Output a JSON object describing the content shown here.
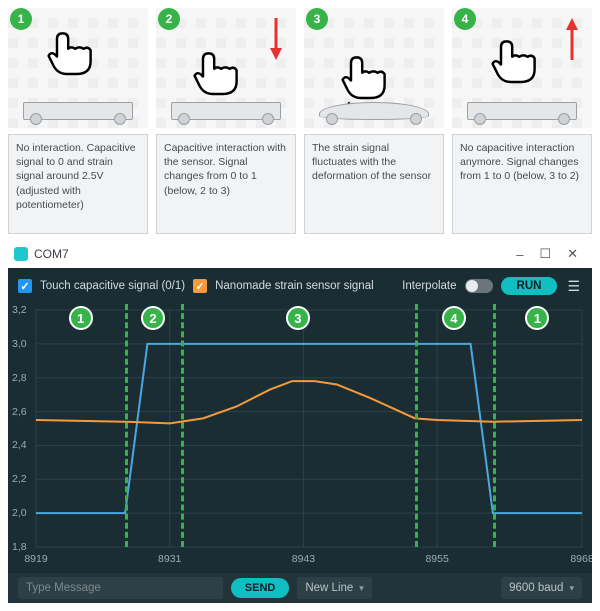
{
  "colors": {
    "badge": "#37b34a",
    "cap": "#4aa8e0",
    "strain": "#f59a3c"
  },
  "steps": [
    {
      "n": "1",
      "caption": "No interaction. Capacitive signal to 0 and strain signal around 2.5V (adjusted with potentiometer)"
    },
    {
      "n": "2",
      "caption": "Capacitive interaction with the sensor. Signal changes from 0 to 1 (below, 2 to 3)"
    },
    {
      "n": "3",
      "caption": "The strain signal fluctuates with the deformation of the sensor"
    },
    {
      "n": "4",
      "caption": "No capacitive interaction anymore. Signal changes from 1 to 0 (below, 3 to 2)"
    }
  ],
  "window": {
    "title": "COM7",
    "minimize": "–",
    "maximize": "☐",
    "close": "✕"
  },
  "legend": {
    "capacitive": "Touch capacitive signal (0/1)",
    "strain": "Nanomade strain sensor signal",
    "interpolate": "Interpolate",
    "run": "RUN",
    "menu": "☰"
  },
  "footer": {
    "placeholder": "Type Message",
    "send": "SEND",
    "line_ending": "New Line",
    "baud": "9600 baud"
  },
  "chart_data": {
    "type": "line",
    "xlim": [
      8919,
      8968
    ],
    "ylim": [
      1.8,
      3.2
    ],
    "xlabel": "",
    "ylabel": "",
    "xticks": [
      8919,
      8931,
      8943,
      8955,
      8968
    ],
    "yticks": [
      1.8,
      2.0,
      2.2,
      2.4,
      2.6,
      2.8,
      3.0,
      3.2
    ],
    "region_dividers": [
      8927,
      8932,
      8953,
      8960
    ],
    "region_labels": [
      "1",
      "2",
      "3",
      "4",
      "1"
    ],
    "series": [
      {
        "name": "Touch capacitive signal (0/1)",
        "color": "#4aa8e0",
        "x": [
          8919,
          8927,
          8929,
          8958,
          8960,
          8968
        ],
        "y": [
          2.0,
          2.0,
          3.0,
          3.0,
          2.0,
          2.0
        ]
      },
      {
        "name": "Nanomade strain sensor signal",
        "color": "#f59a3c",
        "x": [
          8919,
          8927,
          8931,
          8934,
          8937,
          8940,
          8942,
          8944,
          8946,
          8949,
          8951,
          8953,
          8955,
          8960,
          8968
        ],
        "y": [
          2.55,
          2.54,
          2.53,
          2.56,
          2.63,
          2.73,
          2.78,
          2.78,
          2.76,
          2.68,
          2.62,
          2.56,
          2.55,
          2.54,
          2.55
        ]
      }
    ]
  }
}
